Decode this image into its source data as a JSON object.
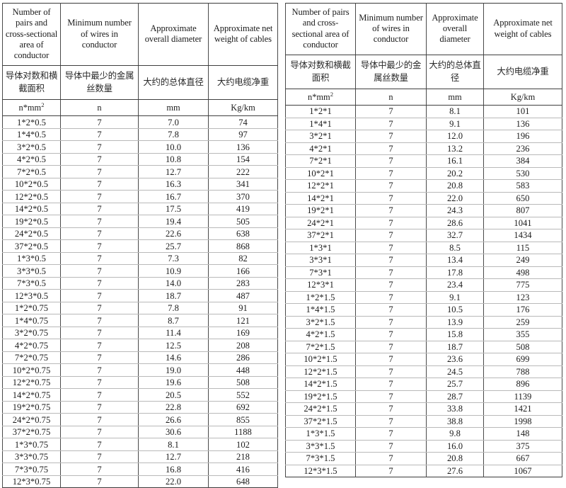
{
  "document": {
    "title": "Cable specification tables",
    "background_color": "#ffffff",
    "text_color": "#1c1c1c",
    "border_color": "#3f3f3f",
    "grid_line_color": "#b9b9b9"
  },
  "tables": [
    {
      "id": "left-table",
      "headers_en": [
        "Number of pairs and cross-sectional area of conductor",
        "Minimum number of wires in conductor",
        "Approximate overall diameter",
        "Approximate net weight of cables"
      ],
      "headers_cn": [
        "导体对数和横截面积",
        "导体中最少的金属丝数量",
        "大约的总体直径",
        "大约电缆净重"
      ],
      "headers_units": [
        "n*mm",
        "n",
        "mm",
        "Kg/km"
      ],
      "unit_superscript": "2",
      "rows": [
        [
          "1*2*0.5",
          "7",
          "7.0",
          "74"
        ],
        [
          "1*4*0.5",
          "7",
          "7.8",
          "97"
        ],
        [
          "3*2*0.5",
          "7",
          "10.0",
          "136"
        ],
        [
          "4*2*0.5",
          "7",
          "10.8",
          "154"
        ],
        [
          "7*2*0.5",
          "7",
          "12.7",
          "222"
        ],
        [
          "10*2*0.5",
          "7",
          "16.3",
          "341"
        ],
        [
          "12*2*0.5",
          "7",
          "16.7",
          "370"
        ],
        [
          "14*2*0.5",
          "7",
          "17.5",
          "419"
        ],
        [
          "19*2*0.5",
          "7",
          "19.4",
          "505"
        ],
        [
          "24*2*0.5",
          "7",
          "22.6",
          "638"
        ],
        [
          "37*2*0.5",
          "7",
          "25.7",
          "868"
        ],
        [
          "1*3*0.5",
          "7",
          "7.3",
          "82"
        ],
        [
          "3*3*0.5",
          "7",
          "10.9",
          "166"
        ],
        [
          "7*3*0.5",
          "7",
          "14.0",
          "283"
        ],
        [
          "12*3*0.5",
          "7",
          "18.7",
          "487"
        ],
        [
          "1*2*0.75",
          "7",
          "7.8",
          "91"
        ],
        [
          "1*4*0.75",
          "7",
          "8.7",
          "121"
        ],
        [
          "3*2*0.75",
          "7",
          "11.4",
          "169"
        ],
        [
          "4*2*0.75",
          "7",
          "12.5",
          "208"
        ],
        [
          "7*2*0.75",
          "7",
          "14.6",
          "286"
        ],
        [
          "10*2*0.75",
          "7",
          "19.0",
          "448"
        ],
        [
          "12*2*0.75",
          "7",
          "19.6",
          "508"
        ],
        [
          "14*2*0.75",
          "7",
          "20.5",
          "552"
        ],
        [
          "19*2*0.75",
          "7",
          "22.8",
          "692"
        ],
        [
          "24*2*0.75",
          "7",
          "26.6",
          "855"
        ],
        [
          "37*2*0.75",
          "7",
          "30.6",
          "1188"
        ],
        [
          "1*3*0.75",
          "7",
          "8.1",
          "102"
        ],
        [
          "3*3*0.75",
          "7",
          "12.7",
          "218"
        ],
        [
          "7*3*0.75",
          "7",
          "16.8",
          "416"
        ],
        [
          "12*3*0.75",
          "7",
          "22.0",
          "648"
        ]
      ]
    },
    {
      "id": "right-table",
      "headers_en": [
        "Number of pairs and cross-sectional area of conductor",
        "Minimum number of wires in conductor",
        "Approximate overall diameter",
        "Approximate net weight of cables"
      ],
      "headers_cn": [
        "导体对数和横截面积",
        "导体中最少的金属丝数量",
        "大约的总体直径",
        "大约电缆净重"
      ],
      "headers_units": [
        "n*mm",
        "n",
        "mm",
        "Kg/km"
      ],
      "unit_superscript": "2",
      "rows": [
        [
          "1*2*1",
          "7",
          "8.1",
          "101"
        ],
        [
          "1*4*1",
          "7",
          "9.1",
          "136"
        ],
        [
          "3*2*1",
          "7",
          "12.0",
          "196"
        ],
        [
          "4*2*1",
          "7",
          "13.2",
          "236"
        ],
        [
          "7*2*1",
          "7",
          "16.1",
          "384"
        ],
        [
          "10*2*1",
          "7",
          "20.2",
          "530"
        ],
        [
          "12*2*1",
          "7",
          "20.8",
          "583"
        ],
        [
          "14*2*1",
          "7",
          "22.0",
          "650"
        ],
        [
          "19*2*1",
          "7",
          "24.3",
          "807"
        ],
        [
          "24*2*1",
          "7",
          "28.6",
          "1041"
        ],
        [
          "37*2*1",
          "7",
          "32.7",
          "1434"
        ],
        [
          "1*3*1",
          "7",
          "8.5",
          "115"
        ],
        [
          "3*3*1",
          "7",
          "13.4",
          "249"
        ],
        [
          "7*3*1",
          "7",
          "17.8",
          "498"
        ],
        [
          "12*3*1",
          "7",
          "23.4",
          "775"
        ],
        [
          "1*2*1.5",
          "7",
          "9.1",
          "123"
        ],
        [
          "1*4*1.5",
          "7",
          "10.5",
          "176"
        ],
        [
          "3*2*1.5",
          "7",
          "13.9",
          "259"
        ],
        [
          "4*2*1.5",
          "7",
          "15.8",
          "355"
        ],
        [
          "7*2*1.5",
          "7",
          "18.7",
          "508"
        ],
        [
          "10*2*1.5",
          "7",
          "23.6",
          "699"
        ],
        [
          "12*2*1.5",
          "7",
          "24.5",
          "788"
        ],
        [
          "14*2*1.5",
          "7",
          "25.7",
          "896"
        ],
        [
          "19*2*1.5",
          "7",
          "28.7",
          "1139"
        ],
        [
          "24*2*1.5",
          "7",
          "33.8",
          "1421"
        ],
        [
          "37*2*1.5",
          "7",
          "38.8",
          "1998"
        ],
        [
          "1*3*1.5",
          "7",
          "9.8",
          "148"
        ],
        [
          "3*3*1.5",
          "7",
          "16.0",
          "375"
        ],
        [
          "7*3*1.5",
          "7",
          "20.8",
          "667"
        ],
        [
          "12*3*1.5",
          "7",
          "27.6",
          "1067"
        ]
      ]
    }
  ]
}
